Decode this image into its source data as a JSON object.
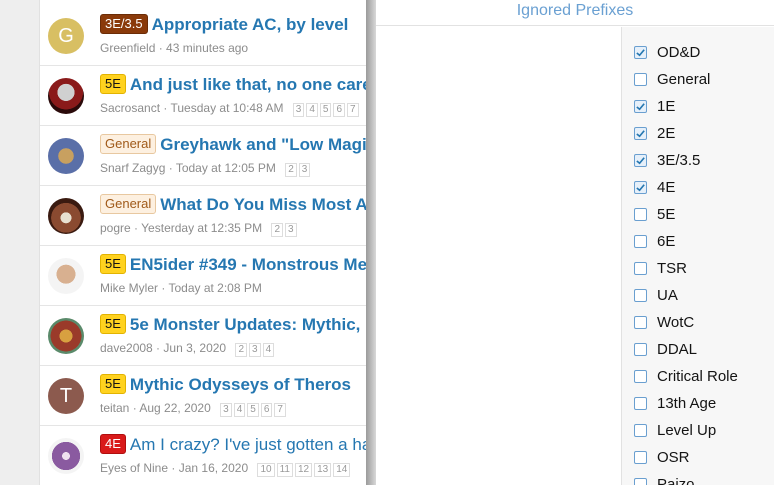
{
  "threads": [
    {
      "avatar_letter": "G",
      "avatar_color": "#d8bf63",
      "prefix": "3E/3.5",
      "title": "Appropriate AC, by level",
      "author": "Greenfield",
      "time": "43 minutes ago",
      "pages": []
    },
    {
      "avatar_letter": "",
      "avatar_color": "#7a1a1a",
      "prefix": "5E",
      "title": "And just like that, no one care",
      "author": "Sacrosanct",
      "time": "Tuesday at 10:48 AM",
      "pages": [
        "3",
        "4",
        "5",
        "6",
        "7"
      ]
    },
    {
      "avatar_letter": "",
      "avatar_color": "#5a6fa8",
      "prefix": "General",
      "title": "Greyhawk and \"Low Magi",
      "author": "Snarf Zagyg",
      "time": "Today at 12:05 PM",
      "pages": [
        "2",
        "3"
      ]
    },
    {
      "avatar_letter": "",
      "avatar_color": "#6b3a2a",
      "prefix": "General",
      "title": "What Do You Miss Most A",
      "author": "pogre",
      "time": "Yesterday at 12:35 PM",
      "pages": [
        "2",
        "3"
      ]
    },
    {
      "avatar_letter": "",
      "avatar_color": "#c9a88a",
      "prefix": "5E",
      "title": "EN5ider #349 - Monstrous Me",
      "author": "Mike Myler",
      "time": "Today at 2:08 PM",
      "pages": []
    },
    {
      "avatar_letter": "",
      "avatar_color": "#9a3a2a",
      "prefix": "5E",
      "title": "5e Monster Updates: Mythic,",
      "author": "dave2008",
      "time": "Jun 3, 2020",
      "pages": [
        "2",
        "3",
        "4"
      ]
    },
    {
      "avatar_letter": "T",
      "avatar_color": "#8c5a4e",
      "prefix": "5E",
      "title": "Mythic Odysseys of Theros",
      "author": "teitan",
      "time": "Aug 22, 2020",
      "pages": [
        "3",
        "4",
        "5",
        "6",
        "7"
      ]
    },
    {
      "avatar_letter": "",
      "avatar_color": "#8a5aa0",
      "prefix": "4E",
      "title": "Am I crazy? I've just gotten a ha",
      "author": "Eyes of Nine",
      "time": "Jan 16, 2020",
      "pages": [
        "10",
        "11",
        "12",
        "13",
        "14"
      ]
    }
  ],
  "panel": {
    "header": "Ignored Prefixes",
    "options": [
      {
        "label": "OD&D",
        "checked": true
      },
      {
        "label": "General",
        "checked": false
      },
      {
        "label": "1E",
        "checked": true
      },
      {
        "label": "2E",
        "checked": true
      },
      {
        "label": "3E/3.5",
        "checked": true
      },
      {
        "label": "4E",
        "checked": true
      },
      {
        "label": "5E",
        "checked": false
      },
      {
        "label": "6E",
        "checked": false
      },
      {
        "label": "TSR",
        "checked": false
      },
      {
        "label": "UA",
        "checked": false
      },
      {
        "label": "WotC",
        "checked": false
      },
      {
        "label": "DDAL",
        "checked": false
      },
      {
        "label": "Critical Role",
        "checked": false
      },
      {
        "label": "13th Age",
        "checked": false
      },
      {
        "label": "Level Up",
        "checked": false
      },
      {
        "label": "OSR",
        "checked": false
      },
      {
        "label": "Paizo",
        "checked": false
      }
    ]
  }
}
